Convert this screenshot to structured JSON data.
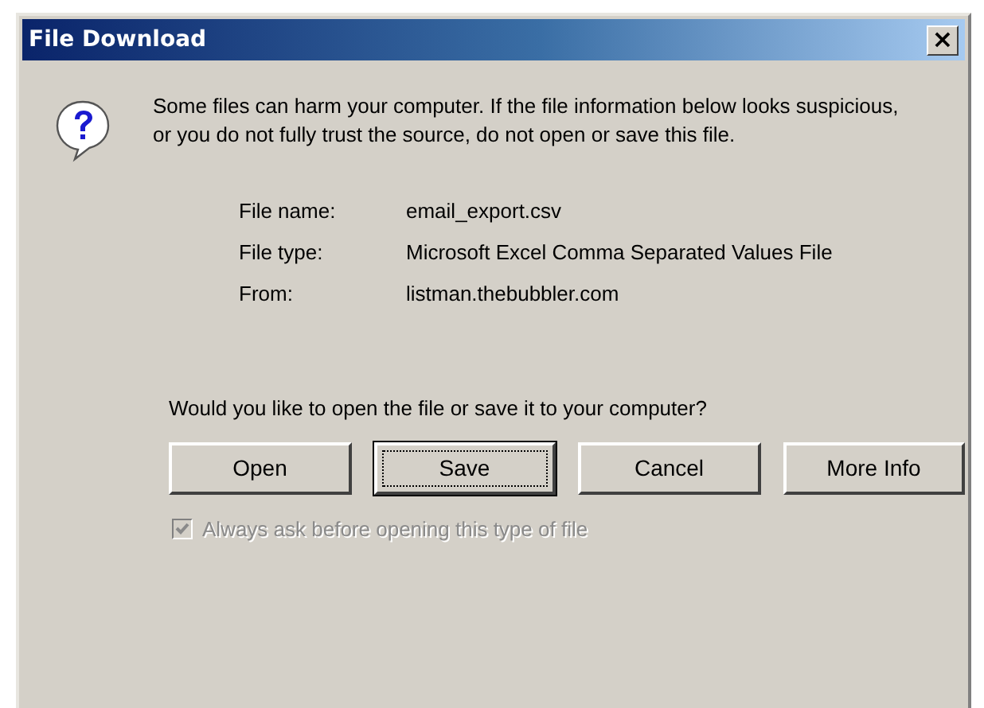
{
  "window": {
    "title": "File Download",
    "close_label": "×"
  },
  "warning": "Some files can harm your computer. If the file information below looks suspicious, or you do not fully trust the source, do not open or save this file.",
  "details": [
    {
      "label": "File name:",
      "value": "email_export.csv"
    },
    {
      "label": "File type:",
      "value": "Microsoft Excel Comma Separated Values File"
    },
    {
      "label": "From:",
      "value": "listman.thebubbler.com"
    }
  ],
  "question": "Would you like to open the file or save it to your computer?",
  "buttons": [
    {
      "label": "Open",
      "selected": false
    },
    {
      "label": "Save",
      "selected": true
    },
    {
      "label": "Cancel",
      "selected": false
    },
    {
      "label": "More Info",
      "selected": false
    }
  ],
  "always_ask": {
    "label": "Always ask before opening this type of file",
    "checked": true,
    "disabled": true
  }
}
